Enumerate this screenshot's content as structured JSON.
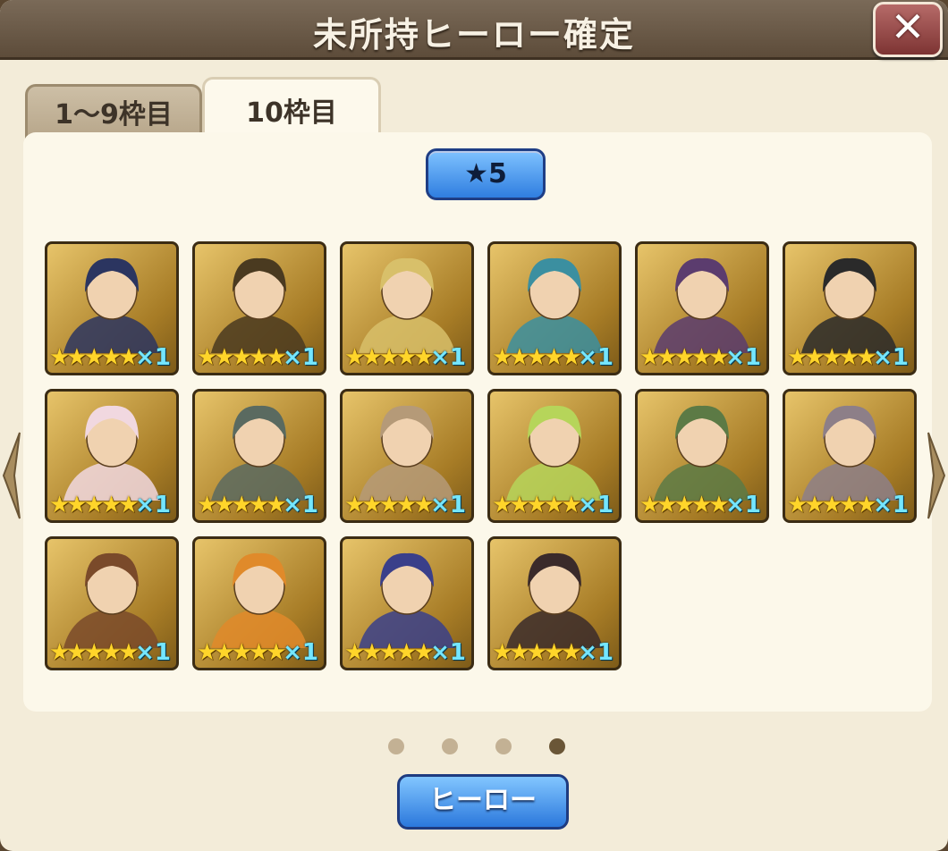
{
  "dialog": {
    "title": "未所持ヒーロー確定",
    "close_glyph": "✕",
    "tabs": [
      {
        "label": "1～9枠目",
        "active": false
      },
      {
        "label": "10枠目",
        "active": true
      }
    ],
    "rarity_filter": {
      "label": "★5"
    },
    "heroes": [
      {
        "stars": "★★★★★",
        "count": "×1",
        "portrait_icon": "cat-girl-hero-icon",
        "tint": "#2b3560"
      },
      {
        "stars": "★★★★★",
        "count": "×1",
        "portrait_icon": "bearded-noble-hero-icon",
        "tint": "#4a3a20"
      },
      {
        "stars": "★★★★★",
        "count": "×1",
        "portrait_icon": "elf-woman-hero-icon",
        "tint": "#d8c06a"
      },
      {
        "stars": "★★★★★",
        "count": "×1",
        "portrait_icon": "twin-tail-girl-hero-icon",
        "tint": "#3b8fa0"
      },
      {
        "stars": "★★★★★",
        "count": "×1",
        "portrait_icon": "demon-beast-hero-icon",
        "tint": "#5b3c6e"
      },
      {
        "stars": "★★★★★",
        "count": "×1",
        "portrait_icon": "hooded-youth-hero-icon",
        "tint": "#2a2a2a"
      },
      {
        "stars": "★★★★★",
        "count": "×1",
        "portrait_icon": "sheep-hood-girl-hero-icon",
        "tint": "#f1d8e0"
      },
      {
        "stars": "★★★★★",
        "count": "×1",
        "portrait_icon": "silver-hair-warrior-hero-icon",
        "tint": "#5a6a60"
      },
      {
        "stars": "★★★★★",
        "count": "×1",
        "portrait_icon": "bandaged-elf-hero-icon",
        "tint": "#b59a78"
      },
      {
        "stars": "★★★★★",
        "count": "×1",
        "portrait_icon": "sprout-girl-hero-icon",
        "tint": "#b6d55a"
      },
      {
        "stars": "★★★★★",
        "count": "×1",
        "portrait_icon": "green-orc-woman-hero-icon",
        "tint": "#5c7a45"
      },
      {
        "stars": "★★★★★",
        "count": "×1",
        "portrait_icon": "doll-girl-hero-icon",
        "tint": "#8d7f88"
      },
      {
        "stars": "★★★★★",
        "count": "×1",
        "portrait_icon": "tribal-man-hero-icon",
        "tint": "#7a4a2a"
      },
      {
        "stars": "★★★★★",
        "count": "×1",
        "portrait_icon": "tiger-beast-hero-icon",
        "tint": "#e08a2a"
      },
      {
        "stars": "★★★★★",
        "count": "×1",
        "portrait_icon": "frog-pilot-hero-icon",
        "tint": "#3a3f8a"
      },
      {
        "stars": "★★★★★",
        "count": "×1",
        "portrait_icon": "glasses-girl-hero-icon",
        "tint": "#3a2a2a"
      }
    ],
    "pagination": {
      "pages": 4,
      "current": 4
    },
    "hero_button": {
      "label": "ヒーロー"
    }
  }
}
